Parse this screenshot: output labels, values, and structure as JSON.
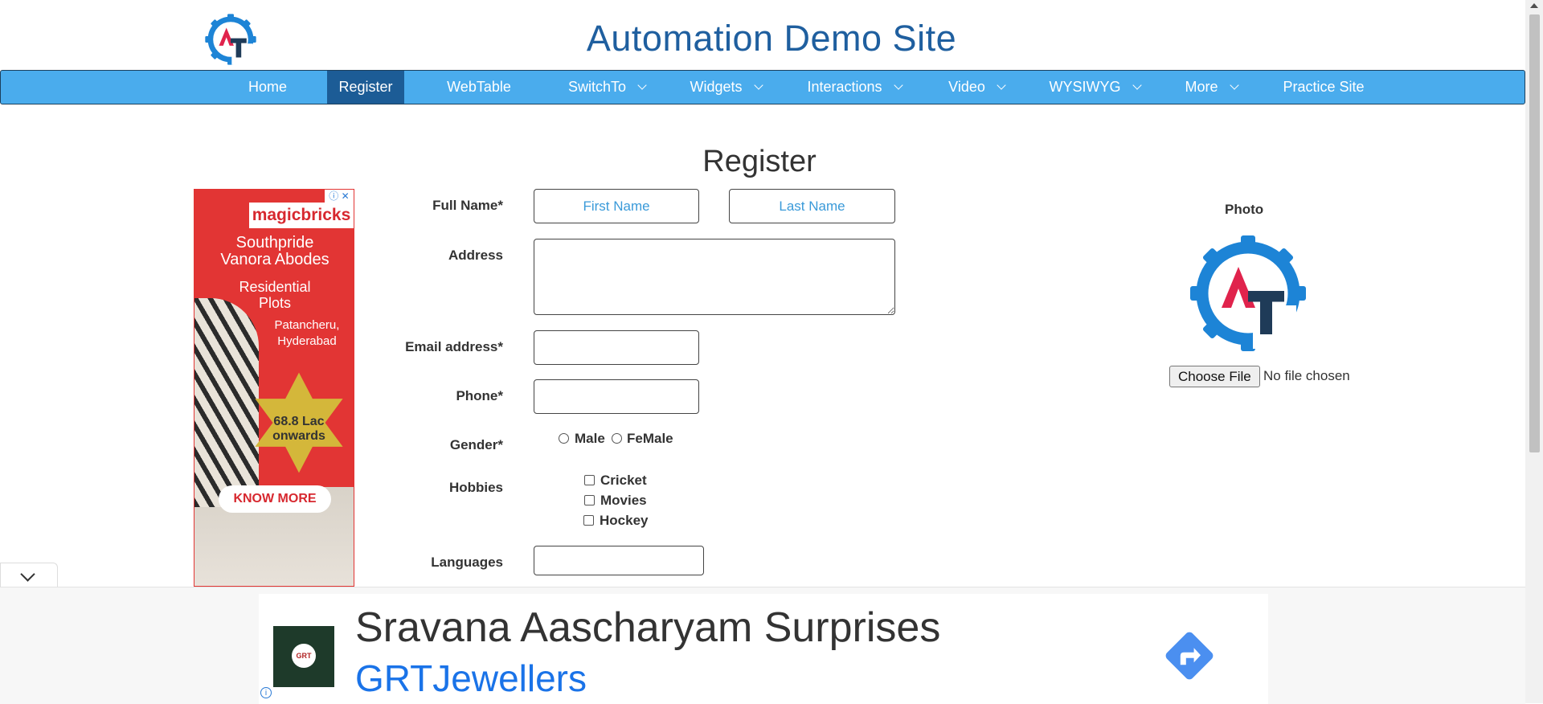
{
  "header": {
    "title": "Automation Demo Site"
  },
  "nav": {
    "items": [
      {
        "label": "Home"
      },
      {
        "label": "Register",
        "active": true
      },
      {
        "label": "WebTable"
      },
      {
        "label": "SwitchTo",
        "dropdown": true
      },
      {
        "label": "Widgets",
        "dropdown": true
      },
      {
        "label": "Interactions",
        "dropdown": true
      },
      {
        "label": "Video",
        "dropdown": true
      },
      {
        "label": "WYSIWYG",
        "dropdown": true
      },
      {
        "label": "More",
        "dropdown": true
      },
      {
        "label": "Practice Site"
      }
    ]
  },
  "form": {
    "heading": "Register",
    "full_name_label": "Full Name*",
    "first_name_placeholder": "First Name",
    "last_name_placeholder": "Last Name",
    "address_label": "Address",
    "email_label": "Email address*",
    "phone_label": "Phone*",
    "gender_label": "Gender*",
    "gender_options": [
      "Male",
      "FeMale"
    ],
    "hobbies_label": "Hobbies",
    "hobbies_options": [
      "Cricket",
      "Movies",
      "Hockey"
    ],
    "languages_label": "Languages"
  },
  "photo": {
    "label": "Photo",
    "choose_file_label": "Choose File",
    "no_file_text": "No file chosen"
  },
  "left_ad": {
    "brand": "magicbricks",
    "headline_line1": "Southpride",
    "headline_line2": "Vanora Abodes",
    "sub_line1": "Residential",
    "sub_line2": "Plots",
    "location_line1": "Patancheru,",
    "location_line2": "Hyderabad",
    "price_line1": "68.8 Lac",
    "price_line2": "onwards",
    "cta": "KNOW MORE",
    "colors": {
      "background": "#e23534",
      "star": "#d4b73a"
    }
  },
  "bottom_ad": {
    "headline": "Sravana Aascharyam Surprises",
    "advertiser": "GRTJewellers",
    "logo_text": "GRT",
    "colors": {
      "advertiser": "#1a73e8",
      "go_button": "#4b8ff0"
    }
  },
  "colors": {
    "nav_bg": "#4aaced",
    "nav_active": "#1c5c96",
    "title": "#1f5f9f",
    "placeholder": "#3a9ad9"
  }
}
